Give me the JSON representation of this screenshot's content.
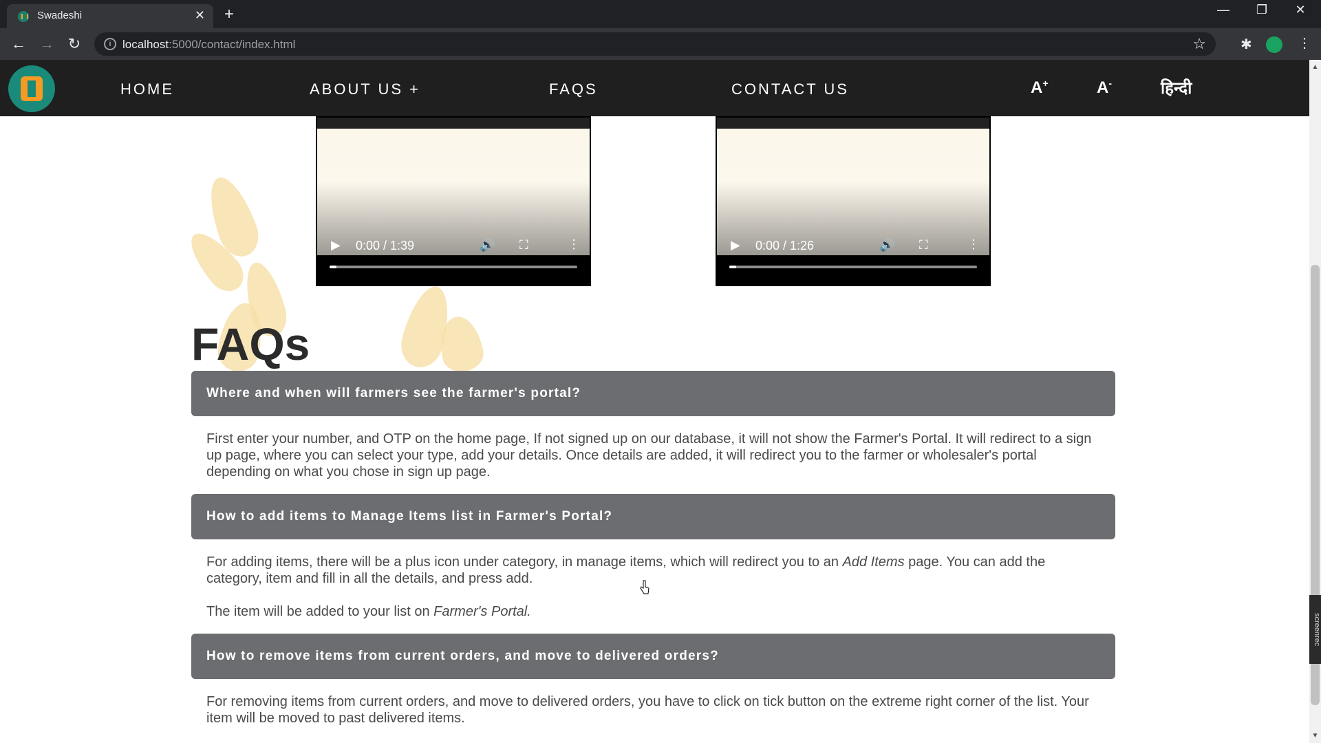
{
  "browser": {
    "tab_title": "Swadeshi",
    "tab_close": "✕",
    "new_tab": "+",
    "url_host": "localhost",
    "url_path": ":5000/contact/index.html"
  },
  "nav": {
    "home": "HOME",
    "about": "ABOUT US +",
    "faqs": "FAQS",
    "contact": "CONTACT US",
    "font_increase": "A",
    "font_increase_sup": "+",
    "font_decrease": "A",
    "font_decrease_sup": "-",
    "language": "हिन्दी"
  },
  "videos": [
    {
      "time": "0:00 / 1:39",
      "progress_fraction": 0.0
    },
    {
      "time": "0:00 / 1:26",
      "progress_fraction": 0.0
    }
  ],
  "faq": {
    "title": "FAQs",
    "items": [
      {
        "question": "Where and when will farmers see the farmer's portal?",
        "answer": "First enter your number, and OTP on the home page, If not signed up on our database, it will not show the Farmer's Portal. It will redirect to a sign up page, where you can select your type, add your details. Once details are added, it will redirect you to the farmer or wholesaler's portal depending on what you chose in sign up page."
      },
      {
        "question": "How to add items to Manage Items list in Farmer's Portal?",
        "answer_pre": "For adding items, there will be a plus icon under category, in manage items, which will redirect you to an ",
        "answer_em": "Add Items",
        "answer_post": " page. You can add the category, item and fill in all the details, and press add.",
        "answer2_pre": "The item will be added to your list on ",
        "answer2_em": "Farmer's Portal."
      },
      {
        "question": "How to remove items from current orders, and move to delivered orders?",
        "answer": "For removing items from current orders, and move to delivered orders, you have to click on tick button on the extreme right corner of the list. Your item will be moved to past delivered items."
      }
    ]
  },
  "screenrec_label": "screenrec"
}
